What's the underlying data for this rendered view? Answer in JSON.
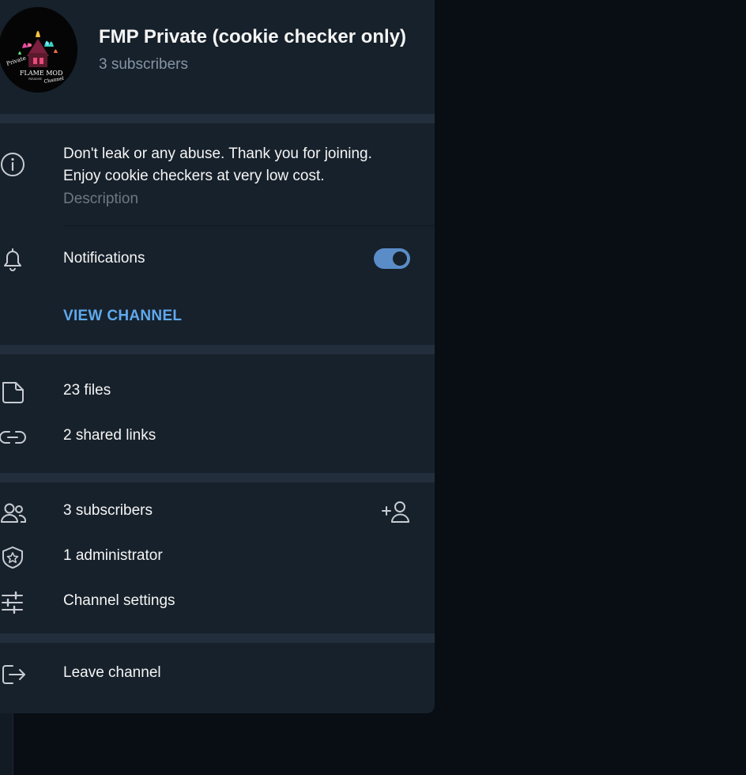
{
  "channel": {
    "name": "FMP Private (cookie checker only)",
    "subscribers_line": "3 subscribers",
    "avatar_icon": "flame-mod-channel-logo-icon",
    "avatar_text": [
      "Private",
      "FLAME MOD",
      "PARADISE",
      "Channel"
    ]
  },
  "about": {
    "description": "Don't leak or any abuse. Thank you for joining. Enjoy cookie checkers at very low cost.",
    "caption": "Description",
    "icon": "info-icon"
  },
  "notifications": {
    "label": "Notifications",
    "enabled": true,
    "icon": "bell-icon"
  },
  "view_channel_label": "VIEW CHANNEL",
  "media": [
    {
      "label": "23 files",
      "icon": "file-icon"
    },
    {
      "label": "2 shared links",
      "icon": "link-icon"
    }
  ],
  "management": {
    "subscribers": {
      "label": "3 subscribers",
      "icon": "users-icon",
      "action_icon": "add-user-icon"
    },
    "administrators": {
      "label": "1 administrator",
      "icon": "shield-star-icon"
    },
    "settings": {
      "label": "Channel settings",
      "icon": "sliders-icon"
    }
  },
  "leave": {
    "label": "Leave channel",
    "icon": "exit-icon"
  },
  "colors": {
    "panel": "#17212b",
    "backdrop": "#090d14",
    "accent": "#5fa9ee",
    "toggle": "#5a8dc8",
    "muted_text": "#8594a5"
  }
}
